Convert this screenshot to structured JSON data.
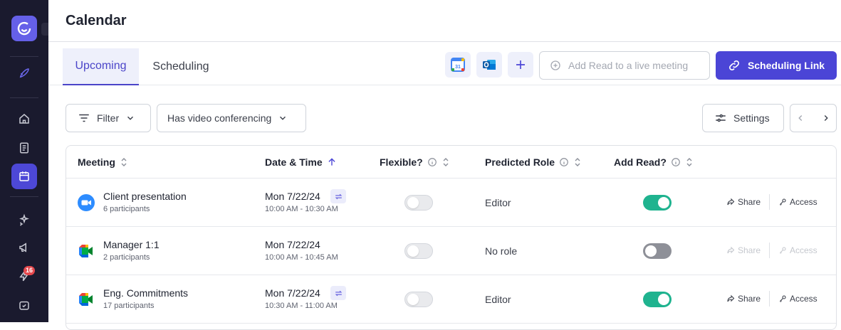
{
  "page": {
    "title": "Calendar"
  },
  "sidebar": {
    "notification_count": "16"
  },
  "tabs": [
    {
      "label": "Upcoming"
    },
    {
      "label": "Scheduling"
    }
  ],
  "actions": {
    "add_read_placeholder": "Add Read to a live meeting",
    "scheduling_link_label": "Scheduling Link",
    "google_calendar_label": "31"
  },
  "toolbar": {
    "filter_label": "Filter",
    "video_filter_label": "Has video conferencing",
    "settings_label": "Settings"
  },
  "table": {
    "headers": {
      "meeting": "Meeting",
      "date_time": "Date & Time",
      "flexible": "Flexible?",
      "predicted_role": "Predicted Role",
      "add_read": "Add Read?"
    },
    "share_label": "Share",
    "access_label": "Access",
    "rows": [
      {
        "name": "Client presentation",
        "participants": "6 participants",
        "date": "Mon 7/22/24",
        "time": "10:00 AM - 10:30 AM",
        "recurring": true,
        "flexible": false,
        "role": "Editor",
        "add_read": true,
        "platform": "zoom"
      },
      {
        "name": "Manager 1:1",
        "participants": "2 participants",
        "date": "Mon 7/22/24",
        "time": "10:00 AM - 10:45 AM",
        "recurring": false,
        "flexible": false,
        "role": "No role",
        "add_read": false,
        "platform": "google-meet"
      },
      {
        "name": "Eng. Commitments",
        "participants": "17 participants",
        "date": "Mon 7/22/24",
        "time": "10:30 AM - 11:00 AM",
        "recurring": true,
        "flexible": false,
        "role": "Editor",
        "add_read": true,
        "platform": "google-meet"
      }
    ]
  },
  "colors": {
    "accent": "#4b45d6",
    "toggle_on": "#1fb38f",
    "sidebar_bg": "#1a1a2e"
  }
}
